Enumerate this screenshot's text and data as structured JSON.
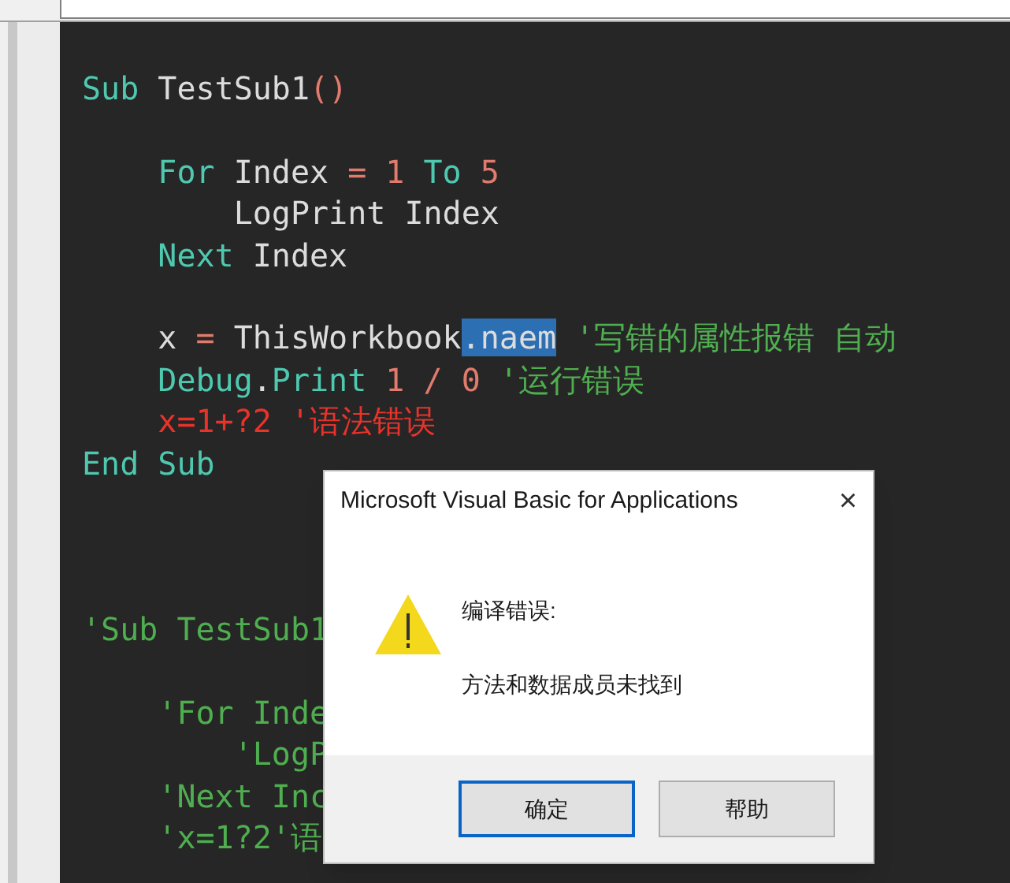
{
  "code": {
    "lines": [
      {
        "kind": "code",
        "tokens": [
          {
            "text": "Sub ",
            "kind": "keyword"
          },
          {
            "text": "TestSub1",
            "kind": "ident"
          },
          {
            "text": "()",
            "kind": "operator"
          }
        ]
      },
      {
        "kind": "blank"
      },
      {
        "kind": "code",
        "tokens": [
          {
            "text": "    For ",
            "kind": "keyword"
          },
          {
            "text": "Index ",
            "kind": "ident"
          },
          {
            "text": "= 1 ",
            "kind": "operator"
          },
          {
            "text": "To ",
            "kind": "keyword"
          },
          {
            "text": "5",
            "kind": "operator"
          }
        ]
      },
      {
        "kind": "code",
        "tokens": [
          {
            "text": "        LogPrint Index",
            "kind": "ident"
          }
        ]
      },
      {
        "kind": "code",
        "tokens": [
          {
            "text": "    Next ",
            "kind": "keyword"
          },
          {
            "text": "Index",
            "kind": "ident"
          }
        ]
      },
      {
        "kind": "blank"
      },
      {
        "kind": "code",
        "tokens": [
          {
            "text": "    x ",
            "kind": "ident"
          },
          {
            "text": "= ",
            "kind": "operator"
          },
          {
            "text": "ThisWorkbook",
            "kind": "ident"
          },
          {
            "text": ".naem",
            "kind": "selected"
          },
          {
            "text": " '写错的属性报错 自动",
            "kind": "comment"
          }
        ]
      },
      {
        "kind": "code",
        "tokens": [
          {
            "text": "    Debug",
            "kind": "keyword"
          },
          {
            "text": ".",
            "kind": "ident"
          },
          {
            "text": "Print ",
            "kind": "keyword"
          },
          {
            "text": "1 / 0 ",
            "kind": "operator"
          },
          {
            "text": "'运行错误",
            "kind": "comment"
          }
        ]
      },
      {
        "kind": "code",
        "tokens": [
          {
            "text": "    x=1+?2 '语法错误",
            "kind": "error"
          }
        ]
      },
      {
        "kind": "code",
        "tokens": [
          {
            "text": "End Sub",
            "kind": "keyword"
          }
        ]
      },
      {
        "kind": "blank"
      },
      {
        "kind": "blank"
      },
      {
        "kind": "blank"
      },
      {
        "kind": "code",
        "tokens": [
          {
            "text": "'Sub TestSub1",
            "kind": "comment"
          }
        ]
      },
      {
        "kind": "blank"
      },
      {
        "kind": "code",
        "tokens": [
          {
            "text": "    'For Inde",
            "kind": "comment"
          }
        ]
      },
      {
        "kind": "code",
        "tokens": [
          {
            "text": "        'LogP",
            "kind": "comment"
          }
        ]
      },
      {
        "kind": "code",
        "tokens": [
          {
            "text": "    'Next Inc",
            "kind": "comment"
          }
        ]
      },
      {
        "kind": "code",
        "tokens": [
          {
            "text": "    'x=1?2'语",
            "kind": "comment"
          }
        ]
      }
    ]
  },
  "dialog": {
    "title": "Microsoft Visual Basic for Applications",
    "close": "×",
    "heading": "编译错误:",
    "message": "方法和数据成员未找到",
    "buttons": [
      {
        "label": "确定",
        "selected": true
      },
      {
        "label": "帮助",
        "selected": false
      }
    ]
  }
}
